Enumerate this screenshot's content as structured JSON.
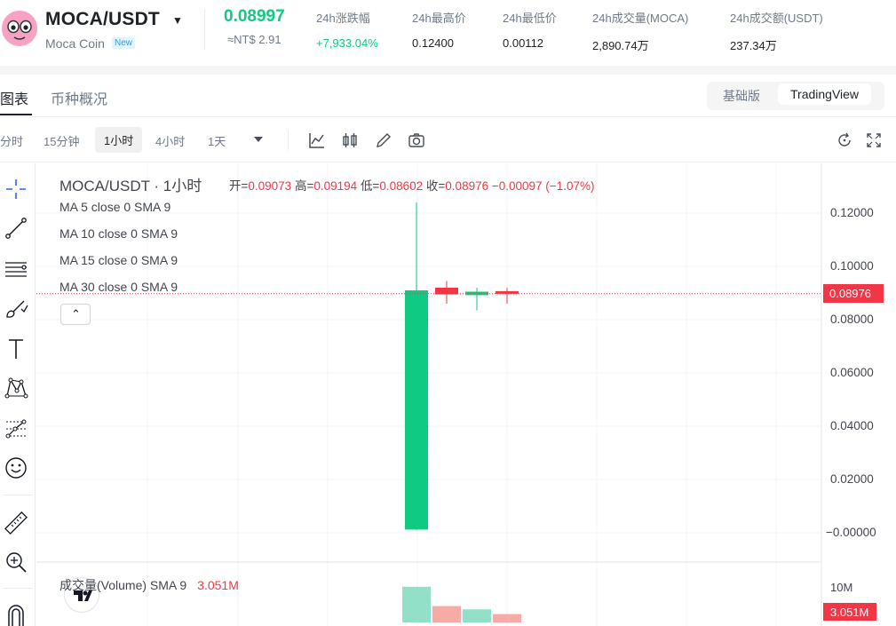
{
  "header": {
    "pair": "MOCA/USDT",
    "coin_name": "Moca Coin",
    "new_badge": "New",
    "last_price": "0.08997",
    "fiat_price": "≈NT$ 2.91",
    "stats": [
      {
        "label": "24h涨跌幅",
        "value": "+7,933.04%",
        "color": "green"
      },
      {
        "label": "24h最高价",
        "value": "0.12400",
        "color": "default"
      },
      {
        "label": "24h最低价",
        "value": "0.00112",
        "color": "default"
      },
      {
        "label": "24h成交量(MOCA)",
        "value": "2,890.74万",
        "color": "default"
      },
      {
        "label": "24h成交额(USDT)",
        "value": "237.34万",
        "color": "default"
      }
    ]
  },
  "tabs": {
    "chart": "图表",
    "overview": "币种概况",
    "basic": "基础版",
    "tradingview": "TradingView"
  },
  "toolbar": {
    "intervals": [
      "分时",
      "15分钟",
      "1小时",
      "4小时",
      "1天"
    ],
    "active_interval": "1小时"
  },
  "legend": {
    "title": "MOCA/USDT · 1小时",
    "open_label": "开=",
    "open": "0.09073",
    "high_label": "高=",
    "high": "0.09194",
    "low_label": "低=",
    "low": "0.08602",
    "close_label": "收=",
    "close": "0.08976",
    "change": "−0.00097 (−1.07%)",
    "ma": [
      "MA 5 close 0 SMA 9",
      "MA 10 close 0 SMA 9",
      "MA 15 close 0 SMA 9",
      "MA 30 close 0 SMA 9"
    ]
  },
  "price_axis": {
    "labels": [
      "0.12000",
      "0.10000",
      "0.08000",
      "0.06000",
      "0.04000",
      "0.02000",
      "−0.00000"
    ],
    "current": "0.08976"
  },
  "volume": {
    "label": "成交量(Volume) SMA 9",
    "value": "3.051M",
    "axis_label": "10M",
    "current": "3.051M"
  },
  "chart_data": {
    "type": "candlestick",
    "y_range": [
      -0.0,
      0.125
    ],
    "candles": [
      {
        "open": 0.0012,
        "high": 0.124,
        "low": 0.0011,
        "close": 0.091,
        "up": true
      },
      {
        "open": 0.092,
        "high": 0.0945,
        "low": 0.086,
        "close": 0.0895,
        "up": false
      },
      {
        "open": 0.0892,
        "high": 0.092,
        "low": 0.0835,
        "close": 0.0905,
        "up": true
      },
      {
        "open": 0.0907,
        "high": 0.0919,
        "low": 0.086,
        "close": 0.0898,
        "up": false
      }
    ],
    "volumes": [
      9.8,
      4.5,
      3.6,
      2.3
    ],
    "volume_range": [
      0,
      12
    ]
  },
  "colors": {
    "up": "#0ecb81",
    "down": "#f23645",
    "vol_up": "#92e0c8",
    "vol_down": "#f7aba6"
  }
}
